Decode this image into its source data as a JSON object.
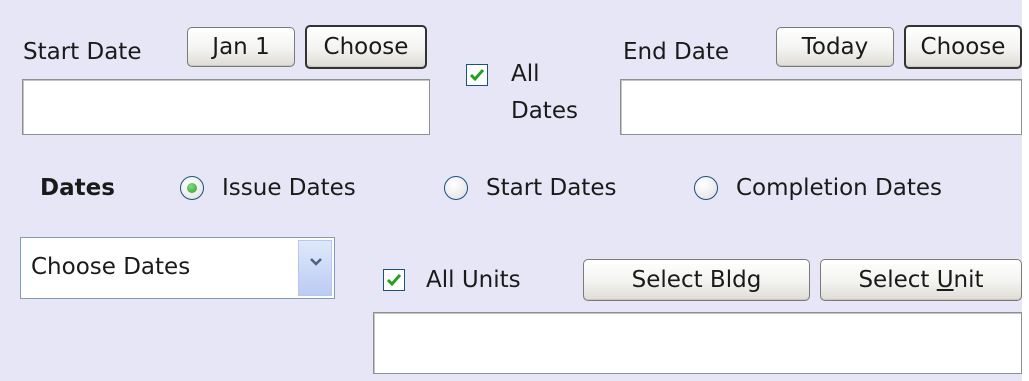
{
  "start_date": {
    "label": "Start Date",
    "jan1_button": "Jan 1",
    "choose_button": "Choose",
    "value": ""
  },
  "all_dates": {
    "line1": "All",
    "line2": "Dates",
    "checked": true
  },
  "end_date": {
    "label": "End Date",
    "today_button": "Today",
    "choose_button": "Choose",
    "value": ""
  },
  "dates_radio": {
    "label": "Dates",
    "options": [
      "Issue Dates",
      "Start Dates",
      "Completion Dates"
    ],
    "selected": "Issue Dates"
  },
  "choose_dates_select": {
    "value": "Choose Dates"
  },
  "units": {
    "all_units_label": "All Units",
    "all_units_checked": true,
    "select_bldg_button": "Select Bldg",
    "select_unit_prefix": "Select ",
    "select_unit_mnemonic": "U",
    "select_unit_suffix": "nit",
    "value": ""
  },
  "colors": {
    "panel_background": "#e6e6f7",
    "check_mark": "#22a022",
    "radio_dot": "#2a9a2a"
  }
}
